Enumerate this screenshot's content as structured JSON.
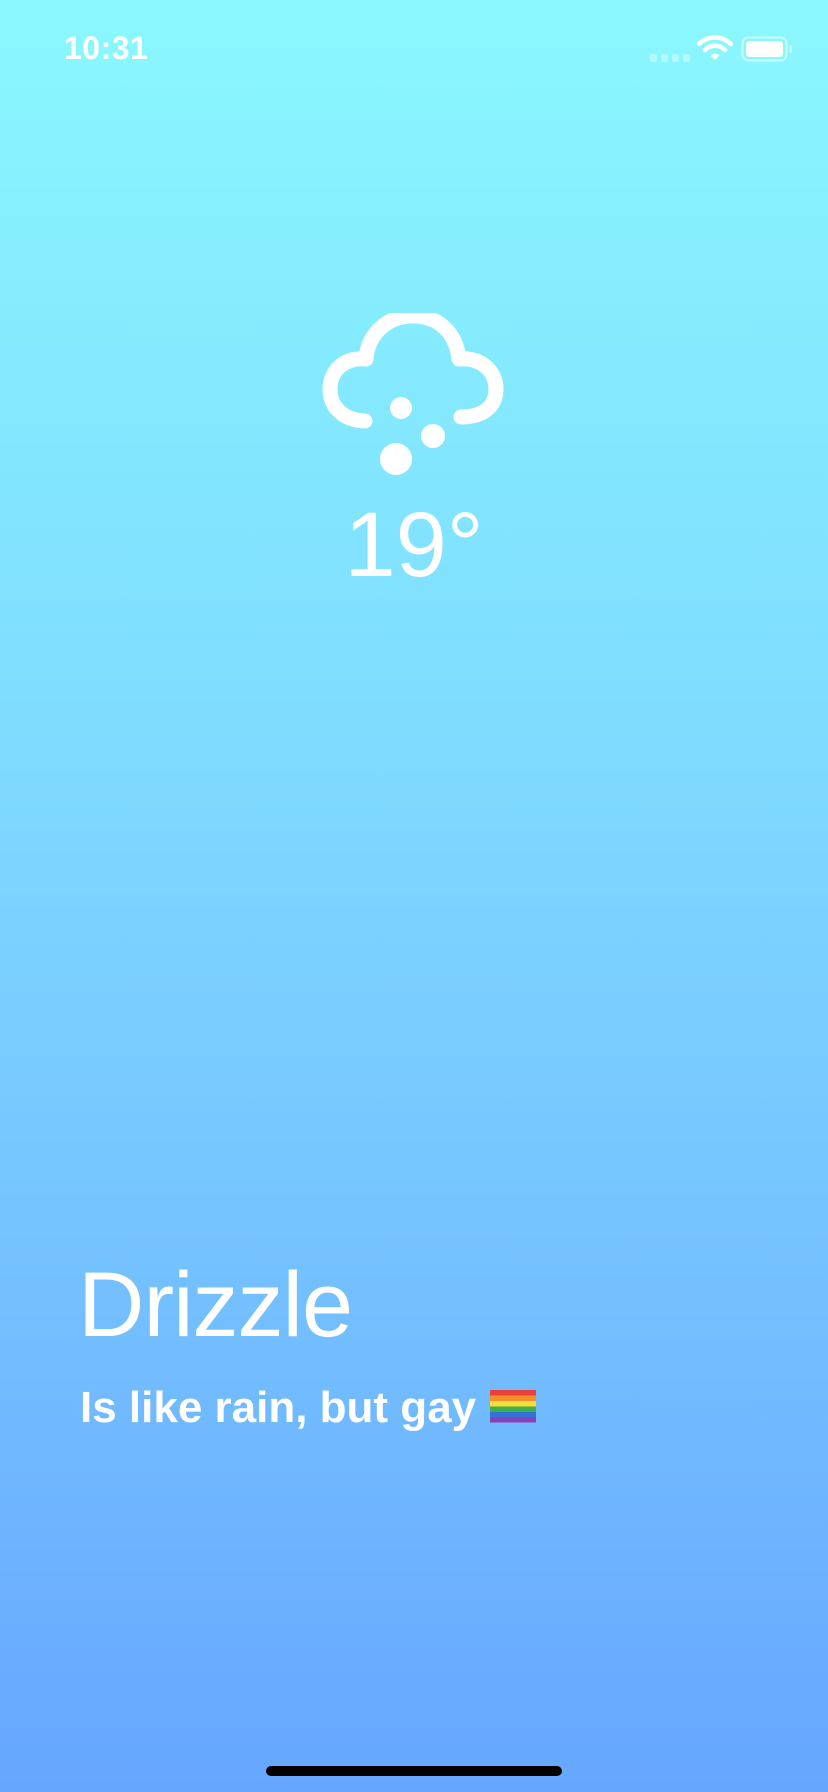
{
  "status_bar": {
    "time": "10:31",
    "icons": [
      "cellular-signal-icon",
      "wifi-icon",
      "battery-icon"
    ]
  },
  "weather": {
    "icon": "cloud-drizzle-icon",
    "temperature": "19°",
    "condition": "Drizzle",
    "description": "Is like rain, but gay",
    "description_icon": "rainbow-flag-icon"
  },
  "colors": {
    "gradient_top": "#8af8fe",
    "gradient_bottom": "#66a6ff",
    "text": "#ffffff"
  }
}
